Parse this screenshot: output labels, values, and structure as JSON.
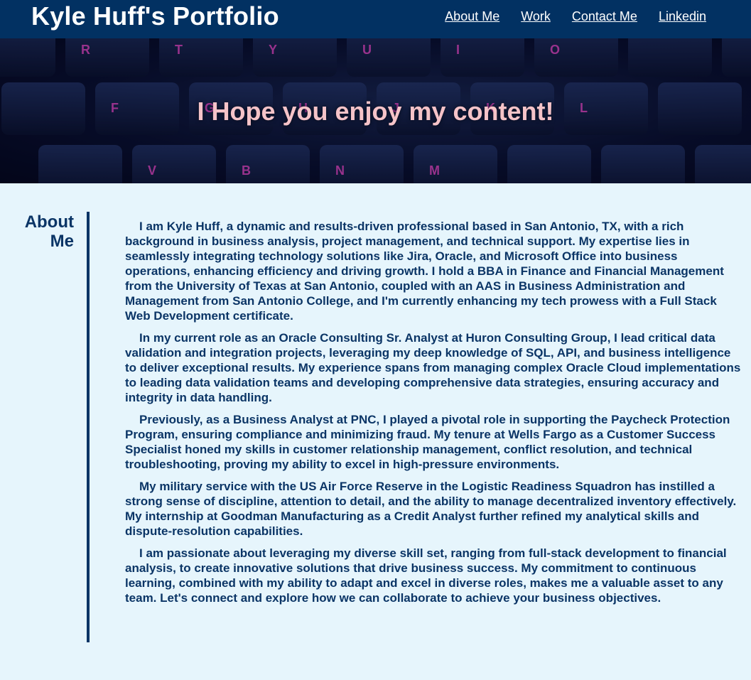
{
  "header": {
    "title": "Kyle Huff's Portfolio",
    "nav": [
      {
        "label": "About Me"
      },
      {
        "label": "Work"
      },
      {
        "label": "Contact Me"
      },
      {
        "label": "Linkedin"
      }
    ]
  },
  "hero": {
    "text": "I Hope you enjoy my content!",
    "background": "keyboard-photo",
    "key_letters": [
      "R",
      "T",
      "Y",
      "U",
      "I",
      "O",
      "F",
      "G",
      "H",
      "J",
      "K",
      "L",
      "V",
      "B",
      "N",
      "M"
    ]
  },
  "about": {
    "heading": "About Me",
    "paragraphs": [
      "I am Kyle Huff, a dynamic and results-driven professional based in San Antonio, TX, with a rich background in business analysis, project management, and technical support. My expertise lies in seamlessly integrating technology solutions like Jira, Oracle, and Microsoft Office into business operations, enhancing efficiency and driving growth. I hold a BBA in Finance and Financial Management from the University of Texas at San Antonio, coupled with an AAS in Business Administration and Management from San Antonio College, and I'm currently enhancing my tech prowess with a Full Stack Web Development certificate.",
      "In my current role as an Oracle Consulting Sr. Analyst at Huron Consulting Group, I lead critical data validation and integration projects, leveraging my deep knowledge of SQL, API, and business intelligence to deliver exceptional results. My experience spans from managing complex Oracle Cloud implementations to leading data validation teams and developing comprehensive data strategies, ensuring accuracy and integrity in data handling.",
      "Previously, as a Business Analyst at PNC, I played a pivotal role in supporting the Paycheck Protection Program, ensuring compliance and minimizing fraud. My tenure at Wells Fargo as a Customer Success Specialist honed my skills in customer relationship management, conflict resolution, and technical troubleshooting, proving my ability to excel in high-pressure environments.",
      "My military service with the US Air Force Reserve in the Logistic Readiness Squadron has instilled a strong sense of discipline, attention to detail, and the ability to manage decentralized inventory effectively. My internship at Goodman Manufacturing as a Credit Analyst further refined my analytical skills and dispute-resolution capabilities.",
      "I am passionate about leveraging my diverse skill set, ranging from full-stack development to financial analysis, to create innovative solutions that drive business success. My commitment to continuous learning, combined with my ability to adapt and excel in diverse roles, makes me a valuable asset to any team. Let's connect and explore how we can collaborate to achieve your business objectives."
    ]
  },
  "colors": {
    "header_bg": "#023162",
    "page_bg": "#e6f5fc",
    "text": "#0b3566",
    "hero_text": "#f5c3c8",
    "key_glow": "#ff4fd8"
  }
}
